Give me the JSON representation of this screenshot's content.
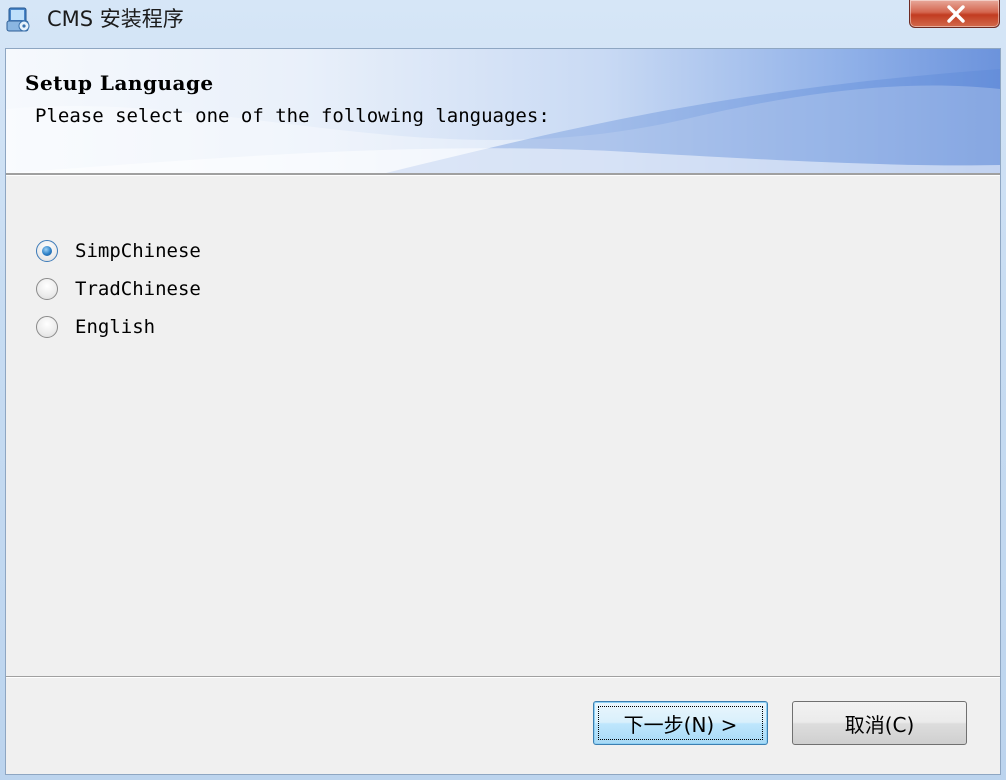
{
  "window": {
    "title": "CMS 安装程序"
  },
  "header": {
    "title": "Setup Language",
    "subtitle": "Please select one of the following languages:"
  },
  "languages": [
    {
      "label": "SimpChinese",
      "checked": true
    },
    {
      "label": "TradChinese",
      "checked": false
    },
    {
      "label": "English",
      "checked": false
    }
  ],
  "buttons": {
    "next_label": "下一步(N) >",
    "cancel_label": "取消(C)"
  },
  "colors": {
    "accent": "#6c93dc",
    "close_button": "#c23c21"
  },
  "icons": {
    "app": "installer-icon",
    "close": "close-icon"
  }
}
